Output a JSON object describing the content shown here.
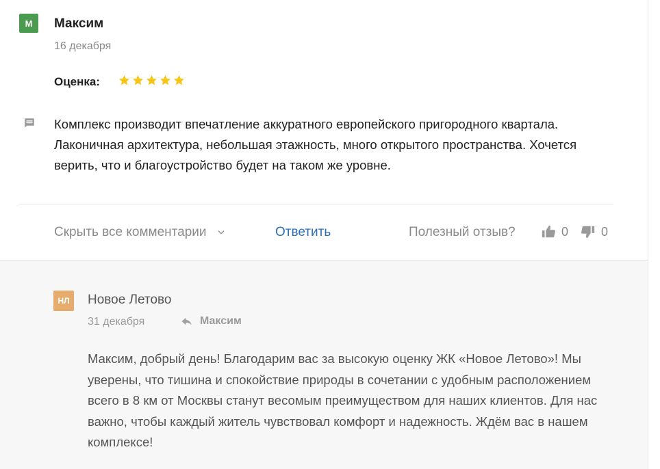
{
  "review": {
    "avatar_letter": "М",
    "author": "Максим",
    "date": "16 декабря",
    "rating_label": "Оценка:",
    "rating": 5,
    "rating_max": 5,
    "text": "Комплекс производит впечатление аккуратного европейского пригородного квартала. Лаконичная архитектура, небольшая этажность, много открытого пространства. Хочется верить, что и благоустройство будет на таком же уровне.",
    "hide_comments_label": "Скрыть все комментарии",
    "reply_label": "Ответить",
    "useful_label": "Полезный отзыв?",
    "likes": "0",
    "dislikes": "0"
  },
  "answer": {
    "avatar_letters": "НЛ",
    "author": "Новое Летово",
    "date": "31 декабря",
    "reply_to": "Максим",
    "text": "Максим, добрый день! Благодарим вас за высокую оценку ЖК «Новое Летово»! Мы уверены, что тишина и спокойствие природы в сочетании с удобным расположением всего в 8 км от Москвы станут весомым преимуществом для наших клиентов. Для нас важно, чтобы каждый житель чувствовал комфорт и надежность. Ждём вас в нашем комплексе!"
  },
  "colors": {
    "star": "#f5c518",
    "avatar_main": "#4a9a4f",
    "avatar_reply": "#e6ac6e",
    "link": "#2a6fb8"
  }
}
